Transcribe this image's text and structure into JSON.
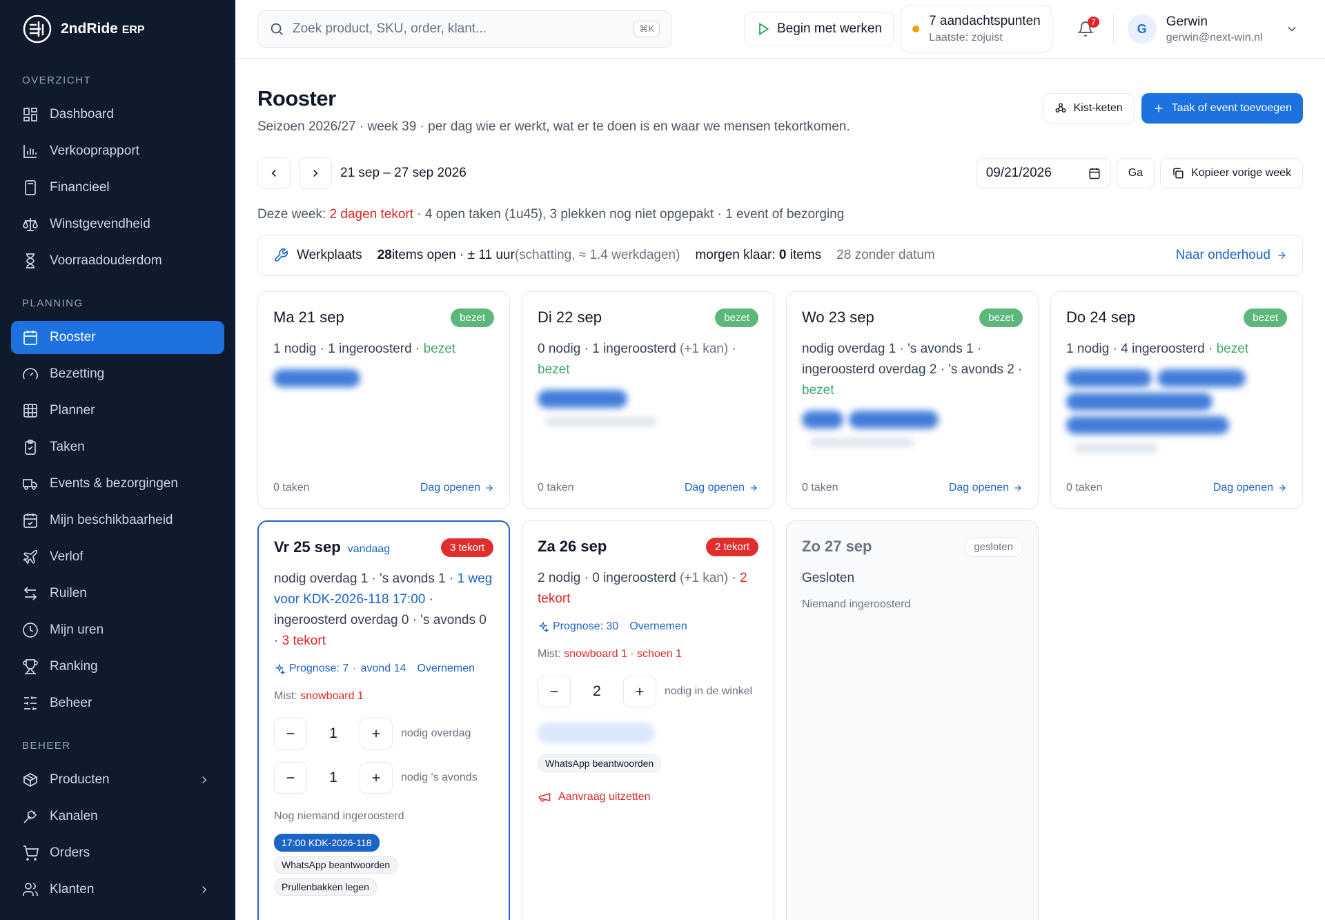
{
  "brand": {
    "name": "2ndRide",
    "suffix": "ERP"
  },
  "nav": {
    "section_overview": "OVERZICHT",
    "overview": [
      {
        "label": "Dashboard",
        "icon": "dashboard-icon"
      },
      {
        "label": "Verkooprapport",
        "icon": "bar-chart-icon"
      },
      {
        "label": "Financieel",
        "icon": "calculator-icon"
      },
      {
        "label": "Winstgevendheid",
        "icon": "scale-icon"
      },
      {
        "label": "Voorraadouderdom",
        "icon": "hourglass-icon"
      }
    ],
    "section_planning": "PLANNING",
    "planning": [
      {
        "label": "Rooster",
        "icon": "calendar-icon",
        "active": true
      },
      {
        "label": "Bezetting",
        "icon": "gauge-icon"
      },
      {
        "label": "Planner",
        "icon": "grid-icon"
      },
      {
        "label": "Taken",
        "icon": "clipboard-icon"
      },
      {
        "label": "Events & bezorgingen",
        "icon": "truck-icon"
      },
      {
        "label": "Mijn beschikbaarheid",
        "icon": "calendar-check-icon"
      },
      {
        "label": "Verlof",
        "icon": "plane-icon"
      },
      {
        "label": "Ruilen",
        "icon": "swap-icon"
      },
      {
        "label": "Mijn uren",
        "icon": "clock-icon"
      },
      {
        "label": "Ranking",
        "icon": "trophy-icon"
      },
      {
        "label": "Beheer",
        "icon": "sliders-icon"
      }
    ],
    "section_manage": "BEHEER",
    "manage": [
      {
        "label": "Producten",
        "icon": "box-icon"
      },
      {
        "label": "Kanalen",
        "icon": "plug-icon"
      },
      {
        "label": "Orders",
        "icon": "cart-icon"
      },
      {
        "label": "Klanten",
        "icon": "users-icon"
      }
    ]
  },
  "topbar": {
    "search_placeholder": "Zoek product, SKU, order, klant...",
    "search_kbd": "⌘K",
    "begin_label": "Begin met werken",
    "attention_title": "7 aandachtspunten",
    "attention_sub": "Laatste: zojuist",
    "bell_count": "7",
    "user_initial": "G",
    "user_name": "Gerwin",
    "user_email": "gerwin@next-win.nl"
  },
  "page": {
    "title": "Rooster",
    "subtitle": "Seizoen 2026/27 · week 39 · per dag wie er werkt, wat er te doen is en waar we mensen tekortkomen.",
    "btn_chain": "Kist-keten",
    "btn_add": "Taak of event toevoegen",
    "week_range": "21 sep – 27 sep 2026",
    "date_value": "09/21/2026",
    "btn_go": "Ga",
    "btn_copy": "Kopieer vorige week"
  },
  "summary": {
    "prefix": "Deze week: ",
    "shortage": "2 dagen tekort",
    "rest": " · 4 open taken (1u45), 3 plekken nog niet opgepakt · 1 event of bezorging"
  },
  "workshop": {
    "label": "Werkplaats",
    "items_count": "28",
    "items_text": " items open · ± 11 uur ",
    "estimate": "(schatting, ≈ 1.4 werkdagen)",
    "tomorrow_prefix": "morgen klaar: ",
    "tomorrow_count": "0",
    "tomorrow_suffix": " items",
    "no_date": "28 zonder datum",
    "link": "Naar onderhoud"
  },
  "days": {
    "footer_tasks": "0 taken",
    "footer_open": "Dag openen",
    "mon": {
      "title": "Ma 21 sep",
      "badge": "bezet",
      "line": "1 nodig · 1 ingeroosterd · ",
      "status": "bezet"
    },
    "tue": {
      "title": "Di 22 sep",
      "badge": "bezet",
      "line": "0 nodig · 1 ingeroosterd ",
      "extra": "(+1 kan)",
      "sep": " · ",
      "status": "bezet"
    },
    "wed": {
      "title": "Wo 23 sep",
      "badge": "bezet",
      "line": "nodig overdag 1 · 's avonds 1 · ingeroosterd overdag 2 · 's avonds 2 · ",
      "status": "bezet"
    },
    "thu": {
      "title": "Do 24 sep",
      "badge": "bezet",
      "line": "1 nodig · 4 ingeroosterd · ",
      "status": "bezet"
    },
    "fri": {
      "title": "Vr 25 sep",
      "today": "vandaag",
      "badge": "3 tekort",
      "line1": "nodig overdag 1 · 's avonds 1 · ",
      "away": "1 weg voor KDK-2026-118",
      "time": "17:00",
      "line2": " · ingeroosterd overdag 0 · 's avonds 0 · ",
      "shortage": "3 tekort",
      "prog_label": "Prognose: 7",
      "prog_sep": " · ",
      "prog_evening": "avond 14",
      "prog_take": "Overnemen",
      "mist_label": "Mist: ",
      "mist_value": "snowboard 1",
      "stepper1_value": "1",
      "stepper1_label": "nodig overdag",
      "stepper2_value": "1",
      "stepper2_label": "nodig 's avonds",
      "note": "Nog niemand ingeroosterd",
      "chip_event": "17:00 KDK-2026-118",
      "chip_task1": "WhatsApp beantwoorden",
      "chip_task2": "Prullenbakken legen"
    },
    "sat": {
      "title": "Za 26 sep",
      "badge": "2 tekort",
      "line": "2 nodig · 0 ingeroosterd ",
      "extra": "(+1 kan)",
      "sep": " · ",
      "shortage": "2 tekort",
      "prog_label": "Prognose: 30",
      "prog_take": "Overnemen",
      "mist_label": "Mist: ",
      "mist_value": "snowboard 1 · schoen 1",
      "stepper_value": "2",
      "stepper_label": "nodig in de winkel",
      "chip_task": "WhatsApp beantwoorden",
      "request": "Aanvraag uitzetten"
    },
    "sun": {
      "title": "Zo 27 sep",
      "badge": "gesloten",
      "status": "Gesloten",
      "note": "Niemand ingeroosterd"
    }
  }
}
